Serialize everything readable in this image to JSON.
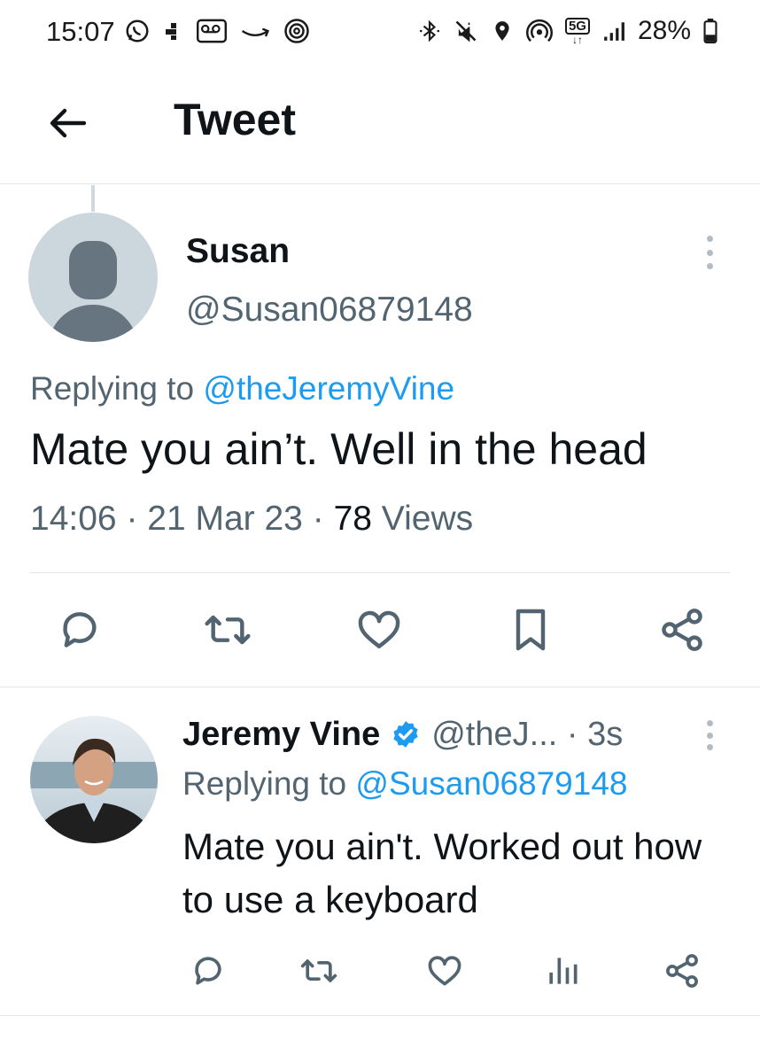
{
  "status_bar": {
    "time": "15:07",
    "battery": "28%",
    "left_icons": [
      "whatsapp-icon",
      "grid-icon",
      "voicemail-icon",
      "amazon-icon",
      "at-icon"
    ],
    "right_icons": [
      "bluetooth-icon",
      "mute-icon",
      "location-icon",
      "hotspot-icon",
      "5g-icon",
      "signal-icon",
      "battery-icon"
    ],
    "network_badge": "5G"
  },
  "header": {
    "title": "Tweet",
    "back_icon": "arrow-left-icon"
  },
  "main_tweet": {
    "name": "Susan",
    "handle": "@Susan06879148",
    "replying_prefix": "Replying to ",
    "replying_to": "@theJeremyVine",
    "text": "Mate you ain’t. Well in the head",
    "time": "14:06",
    "sep1": " · ",
    "date": "21 Mar 23",
    "sep2": " · ",
    "views_count": "78",
    "views_label": " Views",
    "actions": [
      "reply-icon",
      "retweet-icon",
      "like-icon",
      "bookmark-icon",
      "share-icon"
    ]
  },
  "reply_tweet": {
    "name": "Jeremy Vine",
    "handle_time": "@theJ... · 3s",
    "replying_prefix": "Replying to ",
    "replying_to": "@Susan06879148",
    "text": "Mate you ain't. Worked out how to use a keyboard",
    "actions": [
      "reply-icon",
      "retweet-icon",
      "like-icon",
      "views-icon",
      "share-icon"
    ]
  },
  "colors": {
    "accent": "#1d9bf0",
    "secondary_text": "#536471",
    "primary_text": "#0f1419",
    "icon": "#536471",
    "divider": "#e1e6ea"
  }
}
